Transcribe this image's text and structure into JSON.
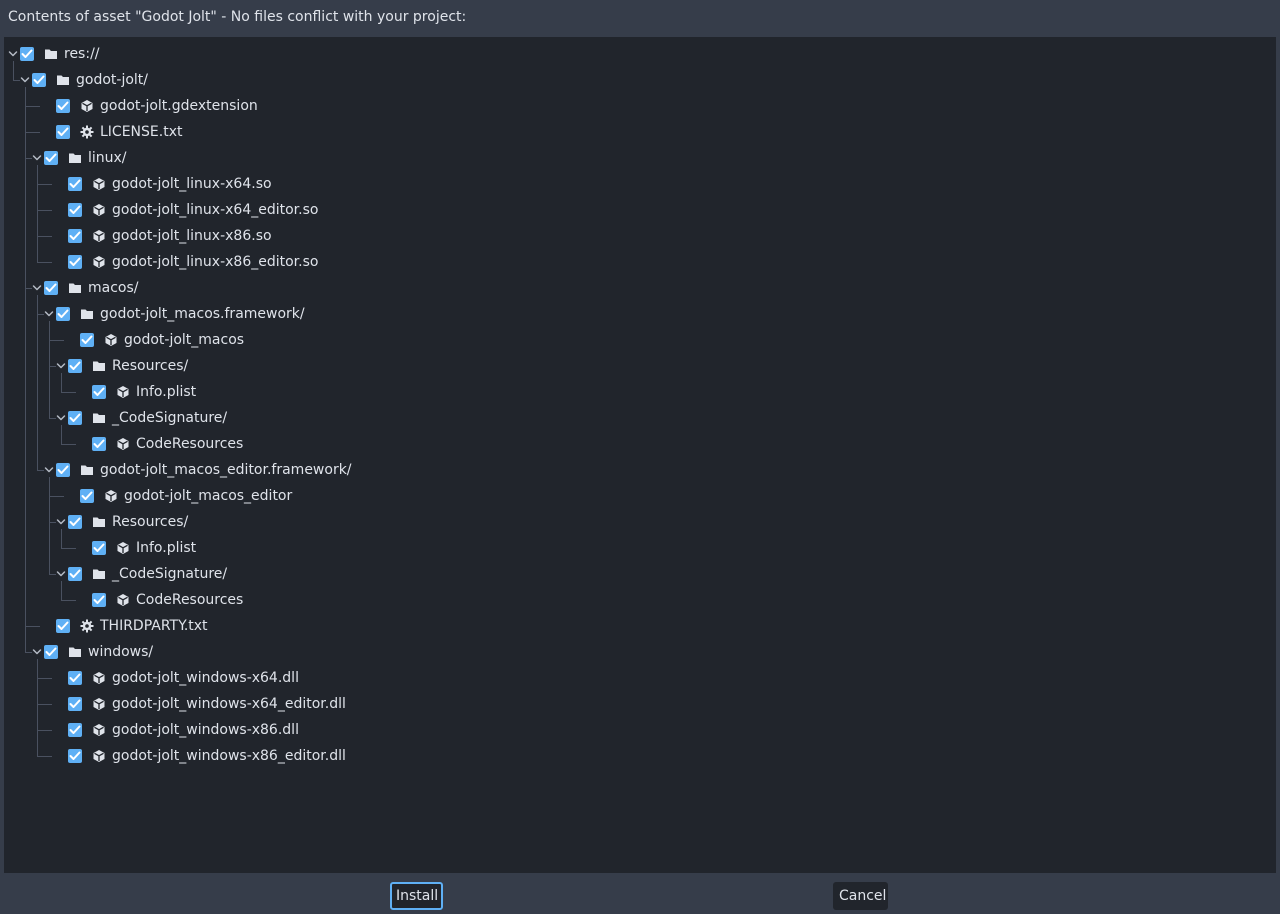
{
  "dialog": {
    "header": "Contents of asset \"Godot Jolt\" - No files conflict with your project:",
    "install_label": "Install",
    "cancel_label": "Cancel"
  },
  "tree": [
    {
      "label": "res://",
      "type": "folder",
      "depth": 0,
      "expanded": true,
      "checked": true
    },
    {
      "label": "godot-jolt/",
      "type": "folder",
      "depth": 1,
      "expanded": true,
      "checked": true
    },
    {
      "label": "godot-jolt.gdextension",
      "type": "file",
      "depth": 2,
      "checked": true,
      "icon": "cube-icon"
    },
    {
      "label": "LICENSE.txt",
      "type": "file",
      "depth": 2,
      "checked": true,
      "icon": "gear-icon"
    },
    {
      "label": "linux/",
      "type": "folder",
      "depth": 2,
      "expanded": true,
      "checked": true
    },
    {
      "label": "godot-jolt_linux-x64.so",
      "type": "file",
      "depth": 3,
      "checked": true,
      "icon": "cube-icon"
    },
    {
      "label": "godot-jolt_linux-x64_editor.so",
      "type": "file",
      "depth": 3,
      "checked": true,
      "icon": "cube-icon"
    },
    {
      "label": "godot-jolt_linux-x86.so",
      "type": "file",
      "depth": 3,
      "checked": true,
      "icon": "cube-icon"
    },
    {
      "label": "godot-jolt_linux-x86_editor.so",
      "type": "file",
      "depth": 3,
      "checked": true,
      "icon": "cube-icon"
    },
    {
      "label": "macos/",
      "type": "folder",
      "depth": 2,
      "expanded": true,
      "checked": true
    },
    {
      "label": "godot-jolt_macos.framework/",
      "type": "folder",
      "depth": 3,
      "expanded": true,
      "checked": true
    },
    {
      "label": "godot-jolt_macos",
      "type": "file",
      "depth": 4,
      "checked": true,
      "icon": "cube-icon"
    },
    {
      "label": "Resources/",
      "type": "folder",
      "depth": 4,
      "expanded": true,
      "checked": true
    },
    {
      "label": "Info.plist",
      "type": "file",
      "depth": 5,
      "checked": true,
      "icon": "cube-icon"
    },
    {
      "label": "_CodeSignature/",
      "type": "folder",
      "depth": 4,
      "expanded": true,
      "checked": true
    },
    {
      "label": "CodeResources",
      "type": "file",
      "depth": 5,
      "checked": true,
      "icon": "cube-icon"
    },
    {
      "label": "godot-jolt_macos_editor.framework/",
      "type": "folder",
      "depth": 3,
      "expanded": true,
      "checked": true
    },
    {
      "label": "godot-jolt_macos_editor",
      "type": "file",
      "depth": 4,
      "checked": true,
      "icon": "cube-icon"
    },
    {
      "label": "Resources/",
      "type": "folder",
      "depth": 4,
      "expanded": true,
      "checked": true
    },
    {
      "label": "Info.plist",
      "type": "file",
      "depth": 5,
      "checked": true,
      "icon": "cube-icon"
    },
    {
      "label": "_CodeSignature/",
      "type": "folder",
      "depth": 4,
      "expanded": true,
      "checked": true
    },
    {
      "label": "CodeResources",
      "type": "file",
      "depth": 5,
      "checked": true,
      "icon": "cube-icon"
    },
    {
      "label": "THIRDPARTY.txt",
      "type": "file",
      "depth": 2,
      "checked": true,
      "icon": "gear-icon"
    },
    {
      "label": "windows/",
      "type": "folder",
      "depth": 2,
      "expanded": true,
      "checked": true
    },
    {
      "label": "godot-jolt_windows-x64.dll",
      "type": "file",
      "depth": 3,
      "checked": true,
      "icon": "cube-icon"
    },
    {
      "label": "godot-jolt_windows-x64_editor.dll",
      "type": "file",
      "depth": 3,
      "checked": true,
      "icon": "cube-icon"
    },
    {
      "label": "godot-jolt_windows-x86.dll",
      "type": "file",
      "depth": 3,
      "checked": true,
      "icon": "cube-icon"
    },
    {
      "label": "godot-jolt_windows-x86_editor.dll",
      "type": "file",
      "depth": 3,
      "checked": true,
      "icon": "cube-icon"
    }
  ],
  "colors": {
    "background": "#363d4a",
    "tree_background": "#21252c",
    "accent": "#5fb0f5",
    "text": "#dfe3ea",
    "guide": "#4a5160"
  }
}
